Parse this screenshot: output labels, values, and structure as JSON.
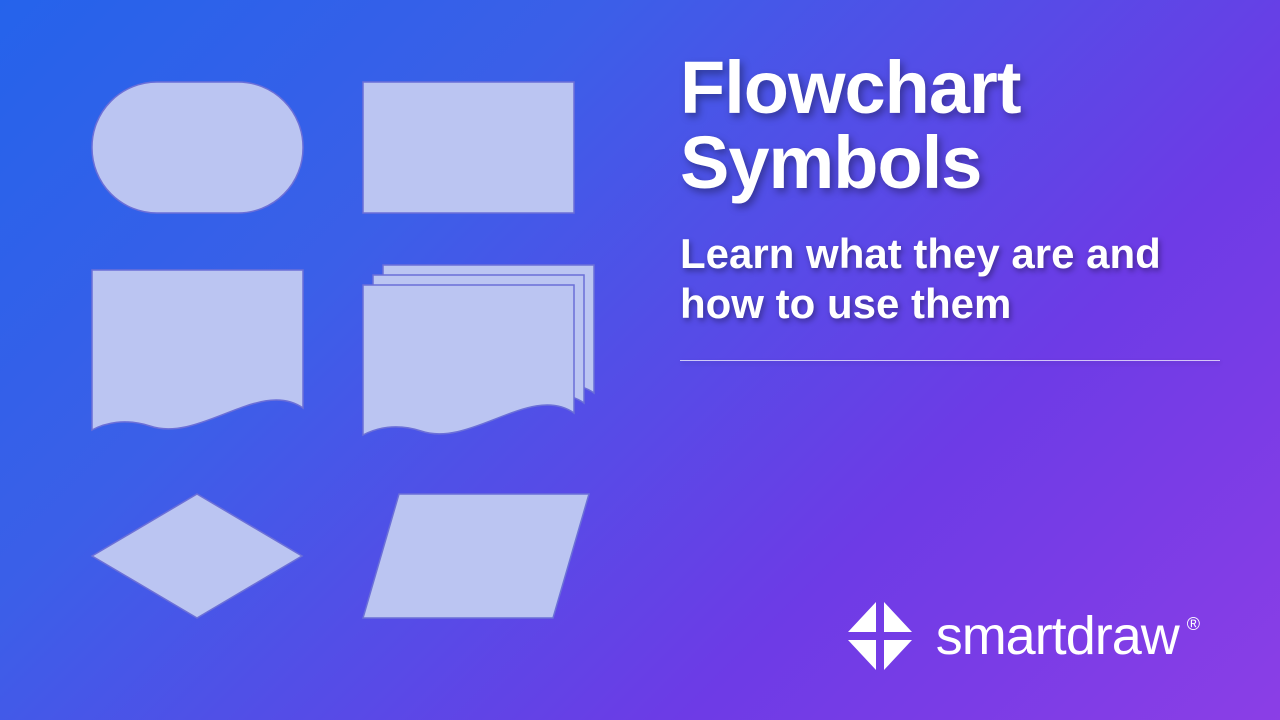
{
  "title": "Flowchart Symbols",
  "subtitle": "Learn what they are and how to use them",
  "brand": "smartdraw",
  "brand_mark": "®",
  "shapes": {
    "row1": [
      "terminator",
      "process"
    ],
    "row2": [
      "document",
      "multi-document"
    ],
    "row3": [
      "decision",
      "data"
    ]
  },
  "colors": {
    "shape_fill": "#bbc5f2",
    "shape_stroke": "#6b6fd8"
  }
}
